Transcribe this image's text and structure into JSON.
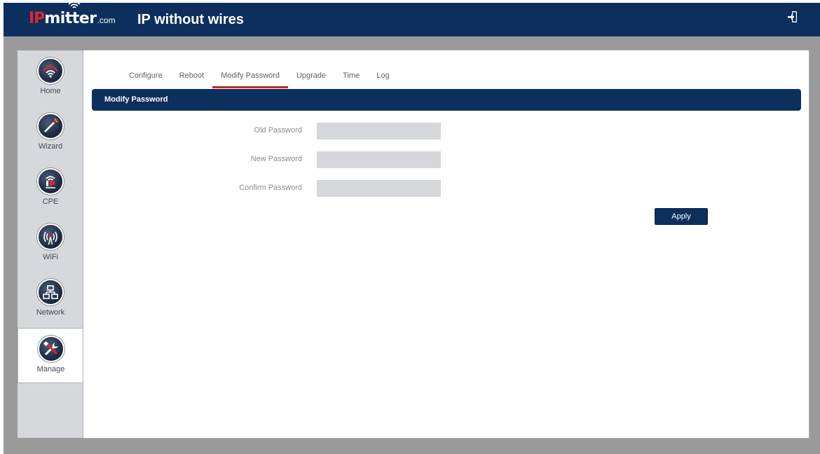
{
  "header": {
    "logo_ip": "IP",
    "logo_mitter": "mitter",
    "logo_com": ".com",
    "tagline": "IP without wires",
    "logout_icon": "logout-icon"
  },
  "sidebar": {
    "items": [
      {
        "label": "Home",
        "icon": "home-wifi-icon",
        "active": false
      },
      {
        "label": "Wizard",
        "icon": "magic-wand-icon",
        "active": false
      },
      {
        "label": "CPE",
        "icon": "ipmitter-cpe-icon",
        "active": false
      },
      {
        "label": "WiFi",
        "icon": "wifi-antenna-icon",
        "active": false
      },
      {
        "label": "Network",
        "icon": "network-icon",
        "active": false
      },
      {
        "label": "Manage",
        "icon": "tools-icon",
        "active": true
      }
    ]
  },
  "tabs": [
    {
      "label": "Configure",
      "active": false
    },
    {
      "label": "Reboot",
      "active": false
    },
    {
      "label": "Modify Password",
      "active": true
    },
    {
      "label": "Upgrade",
      "active": false
    },
    {
      "label": "Time",
      "active": false
    },
    {
      "label": "Log",
      "active": false
    }
  ],
  "section": {
    "title": "Modify Password"
  },
  "form": {
    "old_password_label": "Old Password",
    "old_password_value": "",
    "new_password_label": "New Password",
    "new_password_value": "",
    "confirm_password_label": "Confirm Password",
    "confirm_password_value": "",
    "apply_label": "Apply"
  },
  "colors": {
    "header_bg": "#0d2f5e",
    "accent_red": "#c42a2a",
    "input_bg": "#d5d7da"
  }
}
